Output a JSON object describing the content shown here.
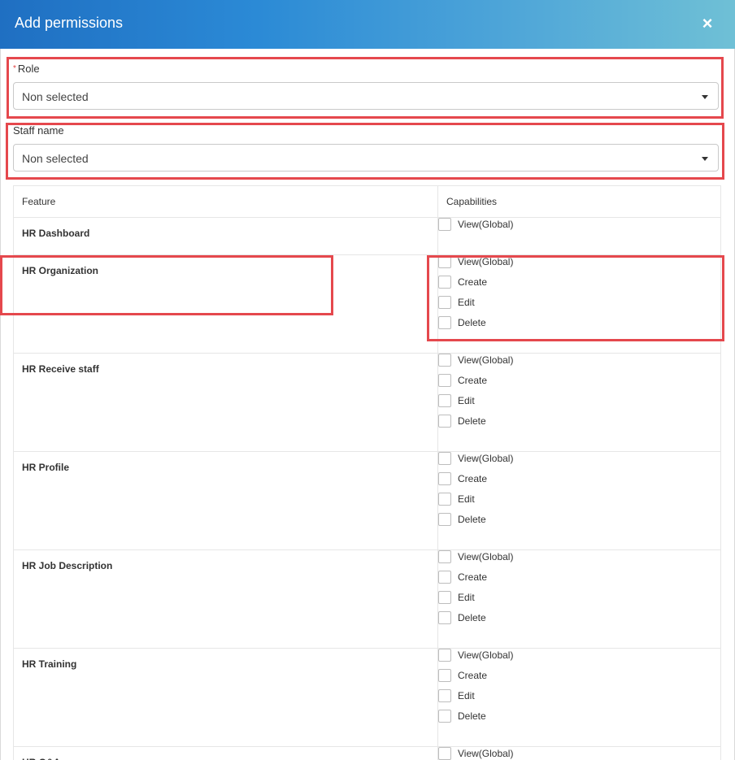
{
  "dialog": {
    "title": "Add permissions",
    "close_label": "×"
  },
  "role": {
    "required_mark": "*",
    "label": "Role",
    "value": "Non selected"
  },
  "staff": {
    "label": "Staff name",
    "value": "Non selected"
  },
  "table": {
    "headers": {
      "feature": "Feature",
      "capabilities": "Capabilities"
    },
    "rows": [
      {
        "feature": "HR Dashboard",
        "capabilities": [
          "View(Global)"
        ]
      },
      {
        "feature": "HR Organization",
        "capabilities": [
          "View(Global)",
          "Create",
          "Edit",
          "Delete"
        ]
      },
      {
        "feature": "HR Receive staff",
        "capabilities": [
          "View(Global)",
          "Create",
          "Edit",
          "Delete"
        ]
      },
      {
        "feature": "HR Profile",
        "capabilities": [
          "View(Global)",
          "Create",
          "Edit",
          "Delete"
        ]
      },
      {
        "feature": "HR Job Description",
        "capabilities": [
          "View(Global)",
          "Create",
          "Edit",
          "Delete"
        ]
      },
      {
        "feature": "HR Training",
        "capabilities": [
          "View(Global)",
          "Create",
          "Edit",
          "Delete"
        ]
      },
      {
        "feature": "HR Q&A",
        "capabilities": [
          "View(Global)"
        ]
      }
    ]
  },
  "colors": {
    "header_gradient_start": "#1f6fc2",
    "header_gradient_end": "#6fc0d6",
    "annotation_red": "#e5484d"
  }
}
